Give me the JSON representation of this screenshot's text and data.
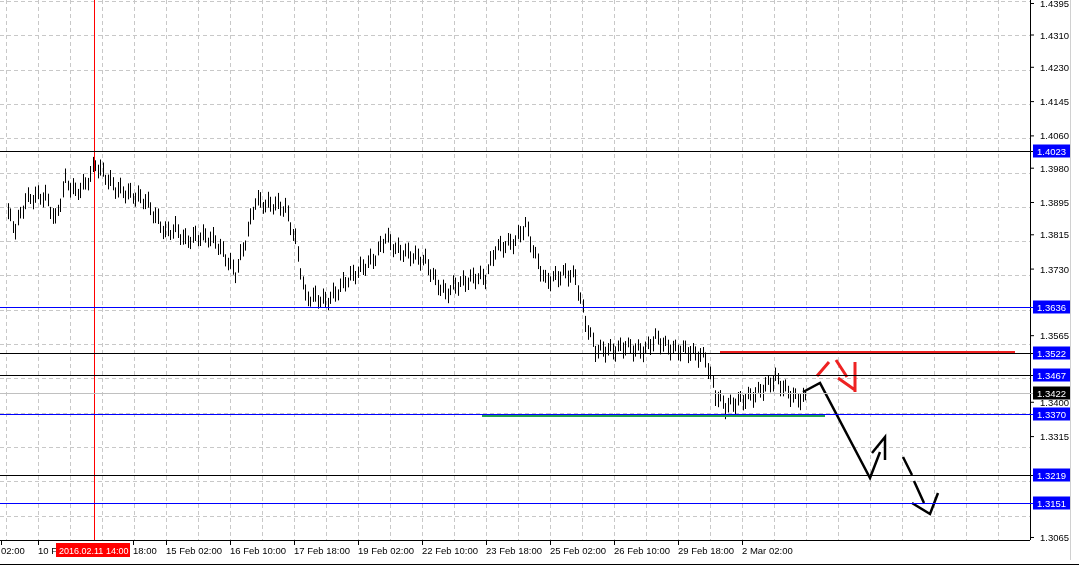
{
  "price_axis": [
    "1.4395",
    "1.4310",
    "1.4230",
    "1.4145",
    "1.4060",
    "1.3980",
    "1.3895",
    "1.3815",
    "1.3730",
    "1.3565",
    "1.3400",
    "1.3315",
    "1.3065"
  ],
  "time_axis": [
    "02:00",
    "10 F",
    "18:00",
    "15 Feb 02:00",
    "16 Feb 10:00",
    "17 Feb 18:00",
    "19 Feb 02:00",
    "22 Feb 10:00",
    "23 Feb 18:00",
    "25 Feb 02:00",
    "26 Feb 10:00",
    "29 Feb 18:00",
    "2 Mar 02:00"
  ],
  "levels": [
    {
      "label": "1.4023",
      "kind": "level",
      "color": "#000000"
    },
    {
      "label": "1.3636",
      "kind": "level",
      "color": "#0000ff"
    },
    {
      "label": "1.3522",
      "kind": "level",
      "color": "#000000"
    },
    {
      "label": "1.3467",
      "kind": "level",
      "color": "#000000"
    },
    {
      "label": "1.3422",
      "kind": "current",
      "color": "#c0c0c0"
    },
    {
      "label": "1.3370",
      "kind": "level",
      "color": "#0000ff"
    },
    {
      "label": "1.3219",
      "kind": "level",
      "color": "#000000"
    },
    {
      "label": "1.3151",
      "kind": "level",
      "color": "#0000ff"
    }
  ],
  "crosshair": {
    "label": "2016.02.11 14:00"
  }
}
